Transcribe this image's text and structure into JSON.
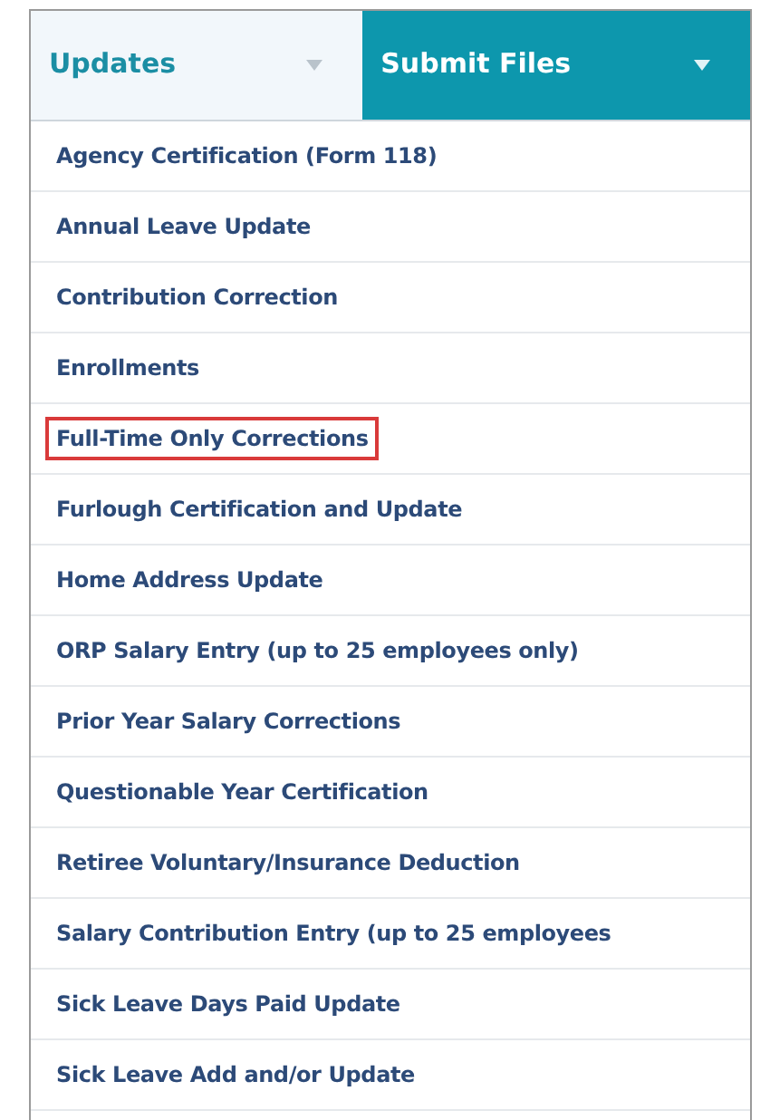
{
  "tabs": [
    {
      "label": "Updates",
      "selected": true
    },
    {
      "label": "Submit Files",
      "selected": false
    }
  ],
  "menu_items": [
    {
      "label": "Agency Certification (Form 118)",
      "highlighted": false
    },
    {
      "label": "Annual Leave Update",
      "highlighted": false
    },
    {
      "label": "Contribution Correction",
      "highlighted": false
    },
    {
      "label": "Enrollments",
      "highlighted": false
    },
    {
      "label": "Full-Time Only Corrections",
      "highlighted": true
    },
    {
      "label": "Furlough Certification and Update",
      "highlighted": false
    },
    {
      "label": "Home Address Update",
      "highlighted": false
    },
    {
      "label": "ORP Salary Entry (up to 25 employees only)",
      "highlighted": false
    },
    {
      "label": "Prior Year Salary Corrections",
      "highlighted": false
    },
    {
      "label": "Questionable Year Certification",
      "highlighted": false
    },
    {
      "label": "Retiree Voluntary/Insurance Deduction",
      "highlighted": false
    },
    {
      "label": "Salary Contribution Entry (up to 25 employees",
      "highlighted": false
    },
    {
      "label": "Sick Leave Days Paid Update",
      "highlighted": false
    },
    {
      "label": "Sick Leave Add and/or Update",
      "highlighted": false
    }
  ]
}
